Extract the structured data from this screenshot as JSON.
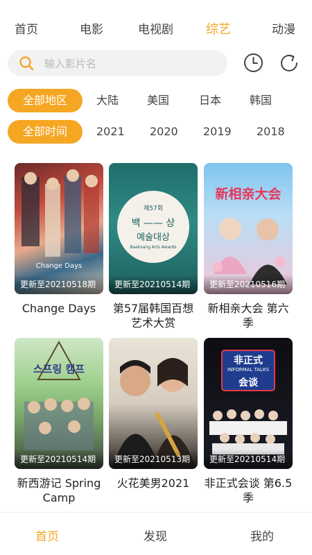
{
  "top_tabs": [
    "首页",
    "电影",
    "电视剧",
    "综艺",
    "动漫"
  ],
  "active_top_tab": "综艺",
  "search": {
    "placeholder": "输入影片名"
  },
  "region_filter": {
    "items": [
      "全部地区",
      "大陆",
      "美国",
      "日本",
      "韩国"
    ],
    "selected": "全部地区"
  },
  "time_filter": {
    "items": [
      "全部时间",
      "2021",
      "2020",
      "2019",
      "2018"
    ],
    "selected": "全部时间"
  },
  "cards": [
    {
      "title": "Change Days",
      "update": "更新至20210518期",
      "poster_text": "Change Days"
    },
    {
      "title": "第57届韩国百想艺术大赏",
      "update": "更新至20210514期",
      "poster_text_1": "제57회",
      "poster_text_2": "백 —— 상",
      "poster_text_3": "예술대상",
      "poster_text_4": "Baeksang Arts Awards"
    },
    {
      "title": "新相亲大会 第六季",
      "update": "更新至20210516期",
      "poster_text": "新相亲大会"
    },
    {
      "title": "新西游记 Spring Camp",
      "update": "更新至20210514期",
      "poster_text": "스프링 캠프"
    },
    {
      "title": "火花美男2021",
      "update": "更新至20210513期"
    },
    {
      "title": "非正式会谈 第6.5季",
      "update": "更新至20210514期",
      "poster_text_1": "非正式",
      "poster_text_2": "INFORMAL TALKS",
      "poster_text_3": "会谈"
    }
  ],
  "bottom_nav": [
    "首页",
    "发现",
    "我的"
  ],
  "active_bottom": "首页",
  "colors": {
    "accent": "#f5a623",
    "text": "#333333",
    "search_bg": "#f2f2f2"
  }
}
